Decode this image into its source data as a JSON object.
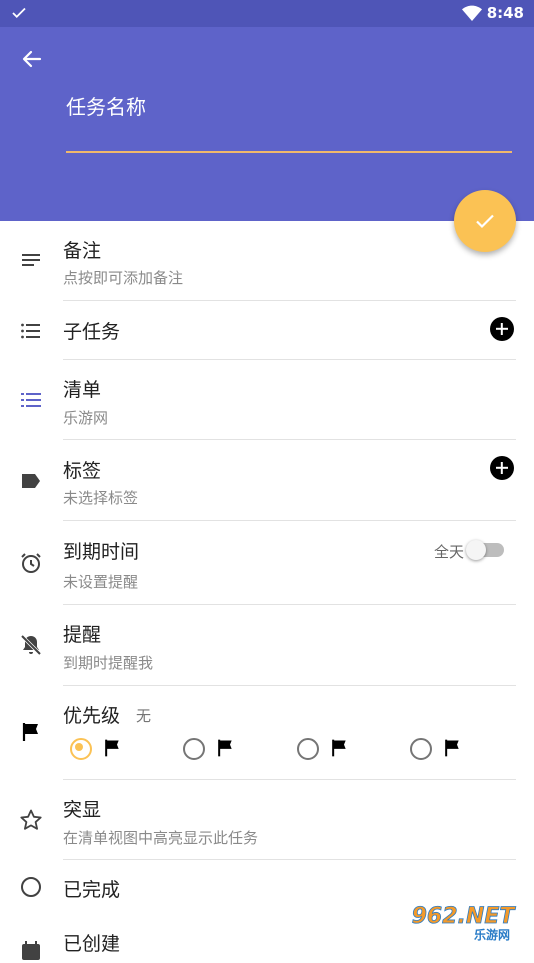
{
  "status_bar": {
    "time": "8:48"
  },
  "header": {
    "task_name_placeholder": "任务名称"
  },
  "rows": {
    "notes": {
      "label": "备注",
      "sub": "点按即可添加备注"
    },
    "subtasks": {
      "label": "子任务"
    },
    "list": {
      "label": "清单",
      "sub": "乐游网"
    },
    "tags": {
      "label": "标签",
      "sub": "未选择标签"
    },
    "due": {
      "label": "到期时间",
      "sub": "未设置提醒",
      "allday_label": "全天"
    },
    "reminder": {
      "label": "提醒",
      "sub": "到期时提醒我"
    },
    "priority": {
      "label": "优先级",
      "value": "无"
    },
    "star": {
      "label": "突显",
      "sub": "在清单视图中高亮显示此任务"
    },
    "completed": {
      "label": "已完成"
    },
    "created": {
      "label": "已创建"
    }
  },
  "watermark": {
    "line1": "962.NET",
    "line2": "乐游网"
  },
  "colors": {
    "primary": "#5e63c9",
    "status_bar": "#4f55b7",
    "accent": "#fbc254",
    "list_icon": "#5e63c9"
  }
}
